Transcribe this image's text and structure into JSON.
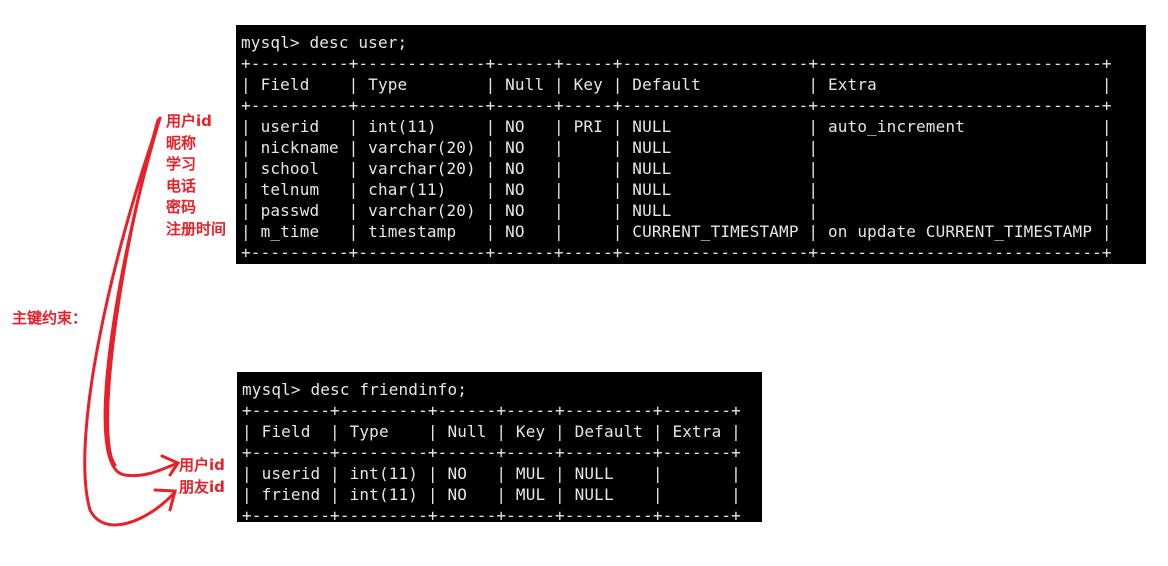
{
  "tables": [
    {
      "prompt": "mysql> desc user;",
      "headers": [
        "Field",
        "Type",
        "Null",
        "Key",
        "Default",
        "Extra"
      ],
      "rows": [
        [
          "userid",
          "int(11)",
          "NO",
          "PRI",
          "NULL",
          "auto_increment"
        ],
        [
          "nickname",
          "varchar(20)",
          "NO",
          "",
          "NULL",
          ""
        ],
        [
          "school",
          "varchar(20)",
          "NO",
          "",
          "NULL",
          ""
        ],
        [
          "telnum",
          "char(11)",
          "NO",
          "",
          "NULL",
          ""
        ],
        [
          "passwd",
          "varchar(20)",
          "NO",
          "",
          "NULL",
          ""
        ],
        [
          "m_time",
          "timestamp",
          "NO",
          "",
          "CURRENT_TIMESTAMP",
          "on update CURRENT_TIMESTAMP"
        ]
      ]
    },
    {
      "prompt": "mysql> desc friendinfo;",
      "headers": [
        "Field",
        "Type",
        "Null",
        "Key",
        "Default",
        "Extra"
      ],
      "rows": [
        [
          "userid",
          "int(11)",
          "NO",
          "MUL",
          "NULL",
          ""
        ],
        [
          "friend",
          "int(11)",
          "NO",
          "MUL",
          "NULL",
          ""
        ]
      ]
    }
  ],
  "annotations": {
    "user_fields": [
      "用户id",
      "昵称",
      "学习",
      "电话",
      "密码",
      "注册时间"
    ],
    "constraint_label": "主键约束：",
    "friend_fields": [
      "用户id",
      "朋友id"
    ],
    "color": "#e8202a"
  }
}
